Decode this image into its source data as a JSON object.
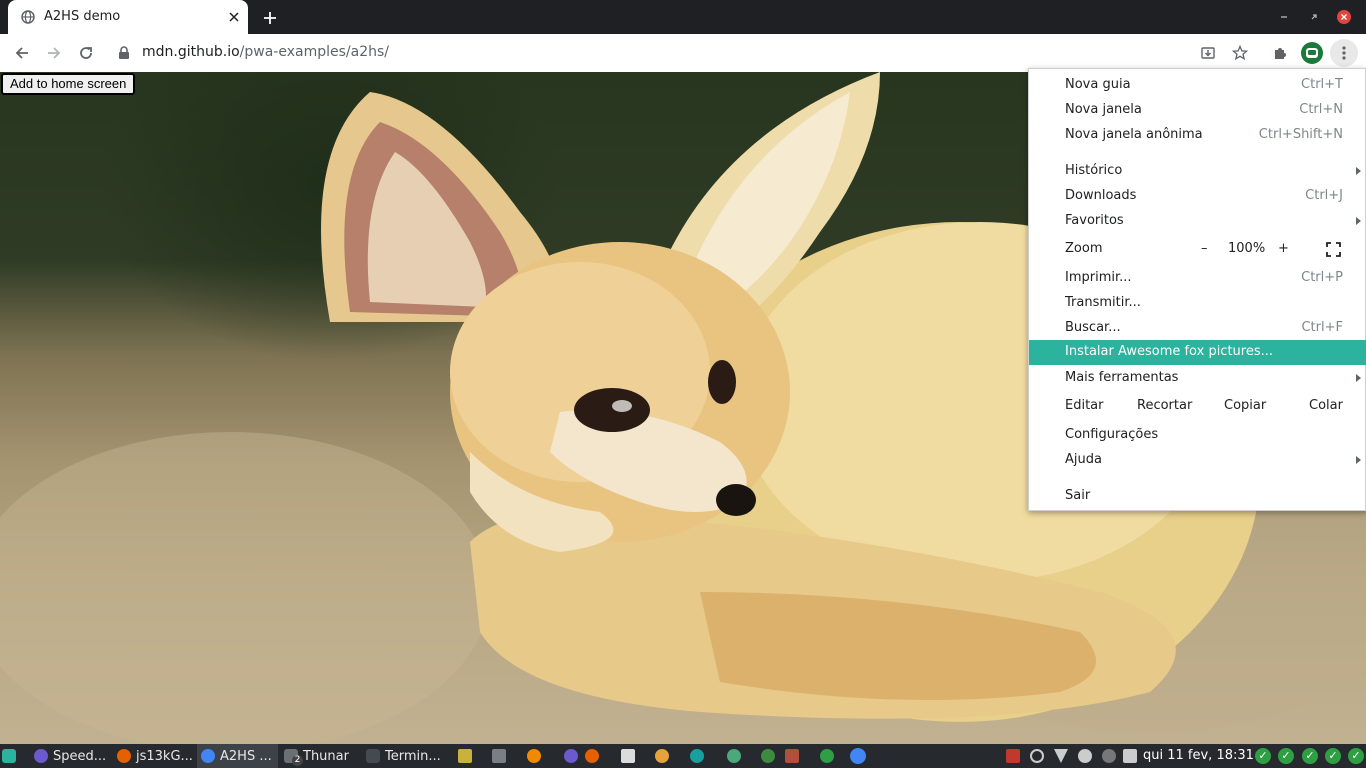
{
  "browser": {
    "tab_title": "A2HS demo",
    "url_host": "mdn.github.io",
    "url_path": "/pwa-examples/a2hs/"
  },
  "page": {
    "a2hs_button": "Add to home screen",
    "image_alt": "Fennec fox"
  },
  "menu": {
    "items": [
      {
        "label": "Nova guia",
        "shortcut": "Ctrl+T"
      },
      {
        "label": "Nova janela",
        "shortcut": "Ctrl+N"
      },
      {
        "label": "Nova janela anônima",
        "shortcut": "Ctrl+Shift+N"
      },
      {
        "label": "Histórico",
        "shortcut": ""
      },
      {
        "label": "Downloads",
        "shortcut": "Ctrl+J"
      },
      {
        "label": "Favoritos",
        "shortcut": ""
      },
      {
        "label": "Zoom",
        "shortcut": ""
      },
      {
        "label": "Imprimir...",
        "shortcut": "Ctrl+P"
      },
      {
        "label": "Transmitir...",
        "shortcut": ""
      },
      {
        "label": "Buscar...",
        "shortcut": "Ctrl+F"
      },
      {
        "label": "Instalar Awesome fox pictures...",
        "shortcut": ""
      },
      {
        "label": "Mais ferramentas",
        "shortcut": ""
      },
      {
        "label": "Editar",
        "shortcut": ""
      },
      {
        "label": "Configurações",
        "shortcut": ""
      },
      {
        "label": "Ajuda",
        "shortcut": ""
      },
      {
        "label": "Sair",
        "shortcut": ""
      }
    ],
    "zoom": {
      "minus": "–",
      "level": "100%",
      "plus": "+"
    },
    "edit": {
      "cut": "Recortar",
      "copy": "Copiar",
      "paste": "Colar"
    },
    "highlight_color": "#2bb39d"
  },
  "taskbar": {
    "items": [
      {
        "label": "Speed..."
      },
      {
        "label": "js13kG..."
      },
      {
        "label": "A2HS ..."
      },
      {
        "label": "Thunar"
      },
      {
        "label": "Termin..."
      }
    ],
    "thunar_badge": "2",
    "clock": "qui 11 fev, 18:31"
  }
}
